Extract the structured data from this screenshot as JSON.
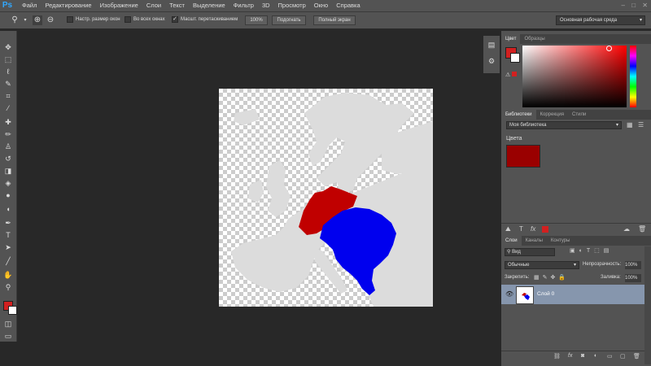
{
  "app": {
    "logo": "Ps"
  },
  "menu": [
    "Файл",
    "Редактирование",
    "Изображение",
    "Слои",
    "Текст",
    "Выделение",
    "Фильтр",
    "3D",
    "Просмотр",
    "Окно",
    "Справка"
  ],
  "options": {
    "resize_windows": "Настр. размер окон",
    "all_windows": "Во всех окнах",
    "scrubby_zoom": "Масшт. перетаскиванием",
    "zoom_100": "100%",
    "fit_screen": "Подогнать",
    "fill_screen": "Полный экран",
    "workspace": "Основная рабочая среда"
  },
  "colors": {
    "foreground": "#d22020",
    "background": "#ffffff",
    "accent_blue": "#0000ee",
    "accent_red": "#c00000"
  },
  "color_panel": {
    "tab_color": "Цвет",
    "tab_swatches": "Образцы"
  },
  "libraries_panel": {
    "tab_libraries": "Библиотеки",
    "tab_adjustments": "Коррекция",
    "tab_styles": "Стили",
    "library_name": "Моя библиотека",
    "section_colors": "Цвета",
    "swatch_color": "#9a0000"
  },
  "layers_panel": {
    "tab_layers": "Слои",
    "tab_channels": "Каналы",
    "tab_paths": "Контуры",
    "filter_kind": "Вид",
    "blend_mode": "Обычные",
    "opacity_label": "Непрозрачность:",
    "opacity_value": "100%",
    "lock_label": "Закрепить:",
    "fill_label": "Заливка:",
    "fill_value": "100%",
    "layers": [
      {
        "name": "Слой 0",
        "visible": true
      }
    ]
  }
}
